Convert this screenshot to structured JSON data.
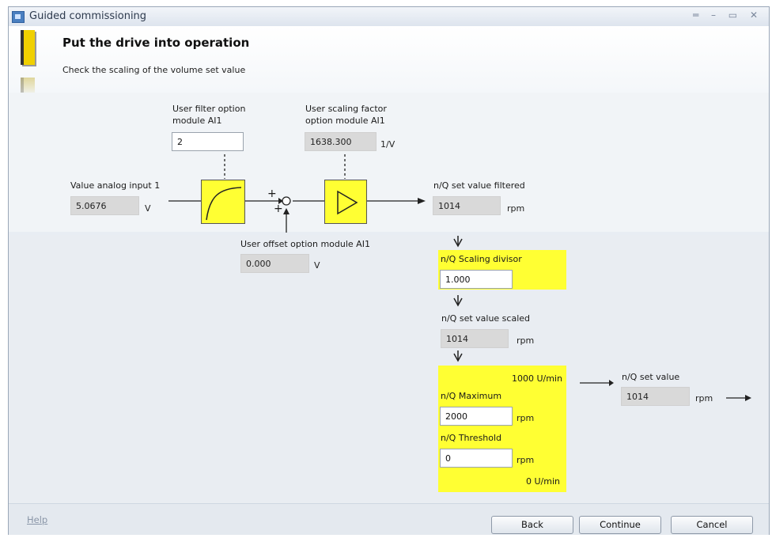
{
  "window": {
    "title": "Guided commissioning",
    "controls": "═ – ▭ ✕"
  },
  "header": {
    "heading": "Put the drive into operation",
    "subheading": "Check the scaling of the volume set value"
  },
  "filter": {
    "label_line1": "User filter option",
    "label_line2": "module AI1",
    "value": "2"
  },
  "scaling": {
    "label_line1": "User scaling factor",
    "label_line2": "option module AI1",
    "value": "1638.300",
    "unit": "1/V"
  },
  "analog_input": {
    "label": "Value analog input 1",
    "value": "5.0676",
    "unit": "V"
  },
  "summing": {
    "plus_top": "+",
    "plus_bottom": "+"
  },
  "offset": {
    "label": "User offset option module AI1",
    "value": "0.000",
    "unit": "V"
  },
  "filtered": {
    "label": "n/Q set value filtered",
    "value": "1014",
    "unit": "rpm"
  },
  "divisor": {
    "label": "n/Q Scaling divisor",
    "value": "1.000"
  },
  "scaled": {
    "label": "n/Q set value scaled",
    "value": "1014",
    "unit": "rpm"
  },
  "limits": {
    "upper_label": "1000 U/min",
    "maximum_label": "n/Q Maximum",
    "maximum_value": "2000",
    "maximum_unit": "rpm",
    "threshold_label": "n/Q Threshold",
    "threshold_value": "0",
    "threshold_unit": "rpm",
    "lower_label": "0 U/min"
  },
  "setvalue": {
    "label": "n/Q set value",
    "value": "1014",
    "unit": "rpm"
  },
  "footer": {
    "help": "Help",
    "back": "Back",
    "continue": "Continue",
    "cancel": "Cancel"
  },
  "colors": {
    "highlight": "#ffff33",
    "readonly": "#d9d9d9"
  }
}
